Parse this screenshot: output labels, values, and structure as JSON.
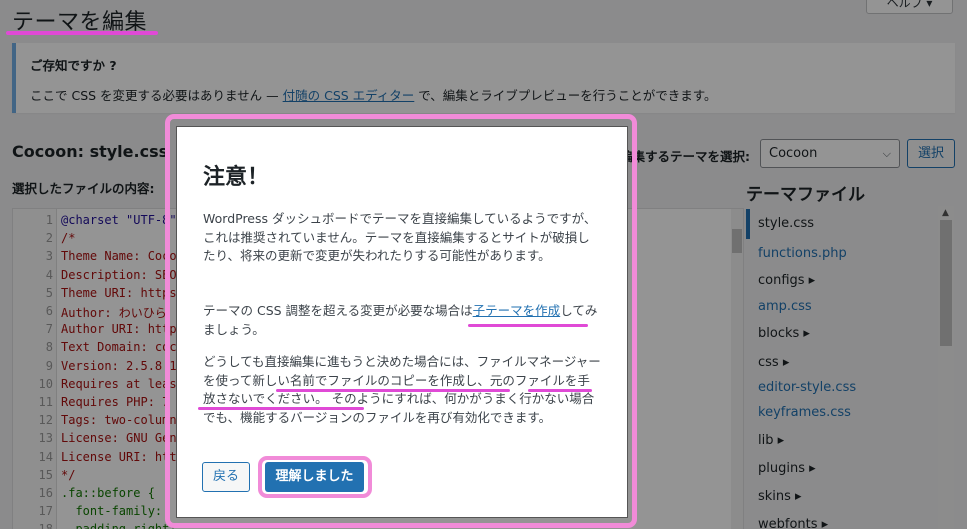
{
  "page": {
    "title": "テーマを編集",
    "help_label": "ヘルプ ▾"
  },
  "notice": {
    "heading": "ご存知ですか ?",
    "text_before": "ここで CSS を変更する必要はありません — ",
    "link": "付随の CSS エディター",
    "text_after": " で、編集とライブプレビューを行うことができます。"
  },
  "editor": {
    "file_title": "Cocoon: style.css",
    "content_label": "選択したファイルの内容:",
    "select_label": "編集するテーマを選択:",
    "theme_value": "Cocoon",
    "select_button": "選択",
    "lines": [
      {
        "n": "1",
        "text": "@charset \"UTF-8\";"
      },
      {
        "n": "2",
        "text": "/*"
      },
      {
        "n": "3",
        "text": "Theme Name: Cocoon"
      },
      {
        "n": "4",
        "text": "Description: SEO"
      },
      {
        "n": "5",
        "text": "Theme URI: https"
      },
      {
        "n": "6",
        "text": "Author: わいひら"
      },
      {
        "n": "7",
        "text": "Author URI: https"
      },
      {
        "n": "8",
        "text": "Text Domain: cocoon"
      },
      {
        "n": "9",
        "text": "Version: 2.5.8.1"
      },
      {
        "n": "10",
        "text": "Requires at least"
      },
      {
        "n": "11",
        "text": "Requires PHP: 7"
      },
      {
        "n": "12",
        "text": "Tags: two-column"
      },
      {
        "n": "13",
        "text": "License: GNU Gen"
      },
      {
        "n": "14",
        "text": "License URI: htt"
      },
      {
        "n": "15",
        "text": "*/"
      },
      {
        "n": "16",
        "text": ".fa::before {"
      },
      {
        "n": "17",
        "text": "  font-family:"
      },
      {
        "n": "18",
        "text": "  padding-right:"
      }
    ]
  },
  "theme_files": {
    "heading": "テーマファイル",
    "items": [
      {
        "label": "style.css",
        "type": "file",
        "current": true
      },
      {
        "label": "functions.php",
        "type": "file"
      },
      {
        "label": "configs ▸",
        "type": "dir"
      },
      {
        "label": "amp.css",
        "type": "file"
      },
      {
        "label": "blocks ▸",
        "type": "dir"
      },
      {
        "label": "css ▸",
        "type": "dir"
      },
      {
        "label": "editor-style.css",
        "type": "file"
      },
      {
        "label": "keyframes.css",
        "type": "file"
      },
      {
        "label": "lib ▸",
        "type": "dir"
      },
      {
        "label": "plugins ▸",
        "type": "dir"
      },
      {
        "label": "skins ▸",
        "type": "dir"
      },
      {
        "label": "webfonts ▸",
        "type": "dir"
      }
    ]
  },
  "dialog": {
    "title": "注意！",
    "p1": "WordPress ダッシュボードでテーマを直接編集しているようですが、これは推奨されていません。テーマを直接編集するとサイトが破損したり、将来の更新で変更が失われたりする可能性があります。",
    "p2_before": "テーマの CSS 調整を超える変更が必要な場合は",
    "p2_link": "子テーマを作成",
    "p2_after": "してみましょう。",
    "p3": "どうしても直接編集に進もうと決めた場合には、ファイルマネージャーを使って新しい名前でファイルのコピーを作成し、元のファイルを手放さないでください。 そのようにすれば、何かがうまく行かない場合でも、機能するバージョンのファイルを再び有効化できます。",
    "back_button": "戻る",
    "ok_button": "理解しました"
  },
  "colors": {
    "accent": "#2271b1",
    "highlight": "#e04ad6",
    "frame": "#f18bd8"
  }
}
